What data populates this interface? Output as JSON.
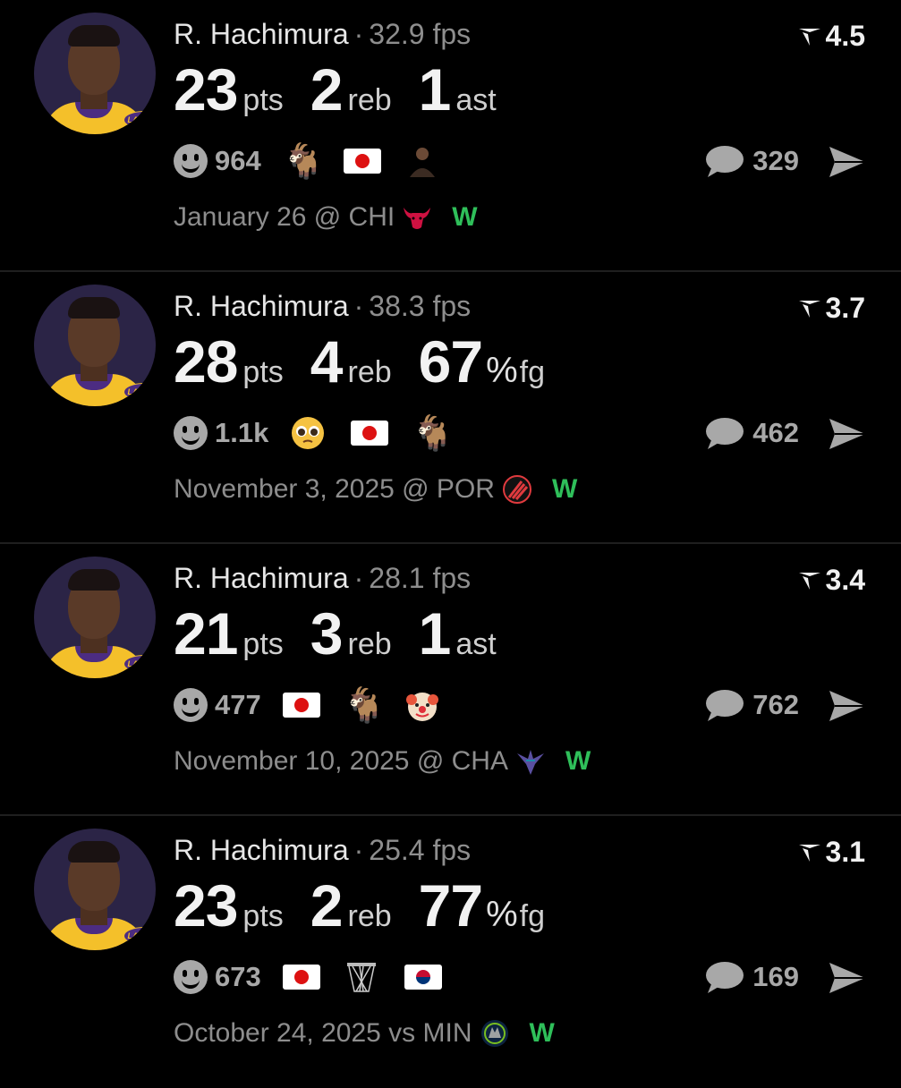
{
  "cards": [
    {
      "player": "R. Hachimura",
      "separator": "·",
      "fps": "32.9 fps",
      "rating": "4.5",
      "stats": [
        {
          "value": "23",
          "unit": "pts"
        },
        {
          "value": "2",
          "unit": "reb"
        },
        {
          "value": "1",
          "unit": "ast"
        }
      ],
      "reaction_count": "964",
      "emojis": [
        "goat-icon",
        "japan-flag-icon",
        "person-icon"
      ],
      "comments": "329",
      "date_opp": "January 26 @ CHI",
      "team_logo": "bulls-logo",
      "result": "W"
    },
    {
      "player": "R. Hachimura",
      "separator": "·",
      "fps": "38.3 fps",
      "rating": "3.7",
      "stats": [
        {
          "value": "28",
          "unit": "pts"
        },
        {
          "value": "4",
          "unit": "reb"
        },
        {
          "value": "67",
          "pct": "%",
          "unit": "fg"
        }
      ],
      "reaction_count": "1.1k",
      "emojis": [
        "pleading-face-icon",
        "japan-flag-icon",
        "goat-icon"
      ],
      "comments": "462",
      "date_opp": "November 3, 2025 @ POR",
      "team_logo": "blazers-logo",
      "result": "W"
    },
    {
      "player": "R. Hachimura",
      "separator": "·",
      "fps": "28.1 fps",
      "rating": "3.4",
      "stats": [
        {
          "value": "21",
          "unit": "pts"
        },
        {
          "value": "3",
          "unit": "reb"
        },
        {
          "value": "1",
          "unit": "ast"
        }
      ],
      "reaction_count": "477",
      "emojis": [
        "japan-flag-icon",
        "goat-icon",
        "clown-face-icon"
      ],
      "comments": "762",
      "date_opp": "November 10, 2025 @ CHA",
      "team_logo": "hornets-logo",
      "result": "W"
    },
    {
      "player": "R. Hachimura",
      "separator": "·",
      "fps": "25.4 fps",
      "rating": "3.1",
      "stats": [
        {
          "value": "23",
          "unit": "pts"
        },
        {
          "value": "2",
          "unit": "reb"
        },
        {
          "value": "77",
          "pct": "%",
          "unit": "fg"
        }
      ],
      "reaction_count": "673",
      "emojis": [
        "japan-flag-icon",
        "basketball-net-icon",
        "south-korea-flag-icon"
      ],
      "comments": "169",
      "date_opp": "October 24, 2025 vs MIN",
      "team_logo": "timberwolves-logo",
      "result": "W"
    }
  ],
  "avatar_logo_text": "LAKERS",
  "colors": {
    "background": "#000000",
    "win": "#2fbf5a",
    "muted": "#8d8d8d",
    "lakers_gold": "#f4c02a",
    "lakers_purple": "#4c2c82"
  }
}
